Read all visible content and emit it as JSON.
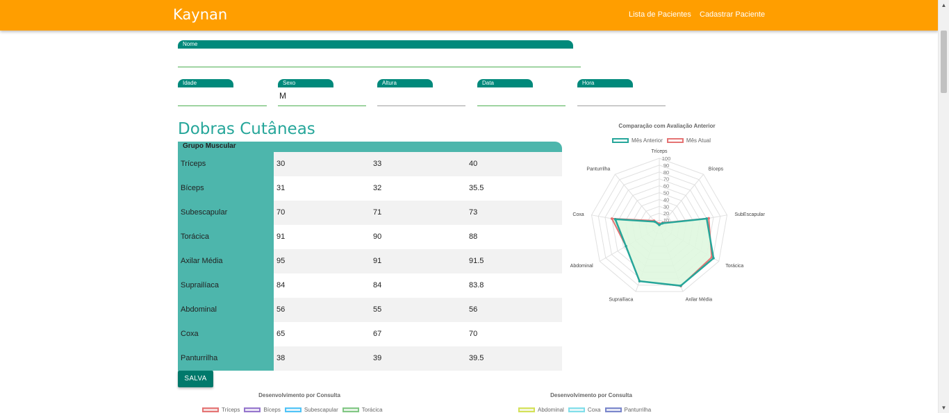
{
  "navbar": {
    "brand": "Kaynan",
    "links": [
      "Lista de Pacientes",
      "Cadastrar Paciente"
    ],
    "color": "#ff9e00"
  },
  "form": {
    "nome": {
      "label": "Nome",
      "value": ""
    },
    "idade": {
      "label": "Idade",
      "value": ""
    },
    "sexo": {
      "label": "Sexo",
      "value": "M"
    },
    "altura": {
      "label": "Altura",
      "value": ""
    },
    "data": {
      "label": "Data",
      "value": ""
    },
    "hora": {
      "label": "Hora",
      "value": ""
    }
  },
  "section": {
    "title": "Dobras Cutâneas"
  },
  "table": {
    "header": "Grupo Muscular",
    "rows": [
      {
        "name": "Tríceps",
        "values": [
          "30",
          "33",
          "40"
        ]
      },
      {
        "name": "Bíceps",
        "values": [
          "31",
          "32",
          "35.5"
        ]
      },
      {
        "name": "Subescapular",
        "values": [
          "70",
          "71",
          "73"
        ]
      },
      {
        "name": "Torácica",
        "values": [
          "91",
          "90",
          "88"
        ]
      },
      {
        "name": "Axilar Média",
        "values": [
          "95",
          "91",
          "91.5"
        ]
      },
      {
        "name": "Suprailíaca",
        "values": [
          "84",
          "84",
          "83.8"
        ]
      },
      {
        "name": "Abdominal",
        "values": [
          "56",
          "55",
          "56"
        ]
      },
      {
        "name": "Coxa",
        "values": [
          "65",
          "67",
          "70"
        ]
      },
      {
        "name": "Panturrilha",
        "values": [
          "38",
          "39",
          "39.5"
        ]
      }
    ]
  },
  "button": {
    "save": "SALVA"
  },
  "chart_data": [
    {
      "type": "radar",
      "title": "Comparação com Avaliação Anterior",
      "labels": [
        "Tríceps",
        "Bíceps",
        "SubEscapular",
        "Torácica",
        "Axilar Média",
        "Suprailíaca",
        "Abdominal",
        "Coxa",
        "Panturrilha"
      ],
      "ticks": [
        "10",
        "20",
        "30",
        "40",
        "50",
        "60",
        "70",
        "80",
        "90",
        "100"
      ],
      "rlim": [
        0,
        100
      ],
      "legend_position": "top",
      "series": [
        {
          "name": "Mês Anterior",
          "color": "#26a69a",
          "values": [
            3,
            7,
            70,
            91,
            91,
            84,
            56,
            65,
            10
          ]
        },
        {
          "name": "Mês Atual",
          "color": "#e57373",
          "values": [
            5,
            8,
            73,
            88,
            91.5,
            83.8,
            56,
            70,
            12
          ]
        }
      ],
      "fill_color": "#dff7df"
    },
    {
      "type": "line",
      "title": "Desenvolvimento por Consulta",
      "legend_position": "top",
      "series": [
        {
          "name": "Tríceps",
          "color": "#e57373"
        },
        {
          "name": "Bíceps",
          "color": "#9575cd"
        },
        {
          "name": "Subescapular",
          "color": "#4fc3f7"
        },
        {
          "name": "Torácica",
          "color": "#81c784"
        }
      ]
    },
    {
      "type": "line",
      "title": "Desenvolvimento por Consulta",
      "legend_position": "top",
      "series": [
        {
          "name": "Abdominal",
          "color": "#d4e157"
        },
        {
          "name": "Coxa",
          "color": "#80deea"
        },
        {
          "name": "Panturrilha",
          "color": "#7986cb"
        }
      ]
    }
  ],
  "scrollbar": {
    "up_icon": "▲",
    "down_icon": "▼"
  }
}
